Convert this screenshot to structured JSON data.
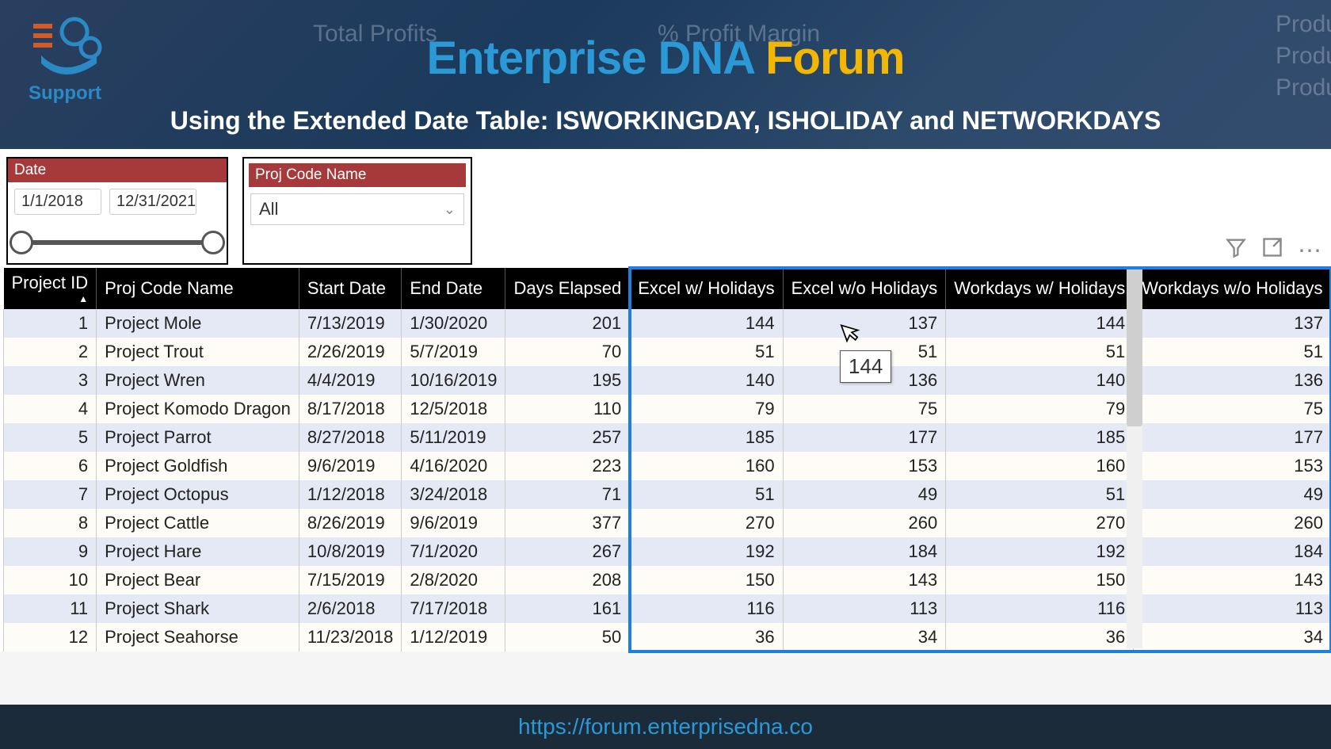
{
  "header": {
    "title_part1": "Enterprise DNA ",
    "title_part2": "Forum",
    "subtitle": "Using the Extended Date Table: ISWORKINGDAY, ISHOLIDAY and NETWORKDAYS",
    "support_label": "Support",
    "bg_profits": "Total Profits",
    "bg_margin": "% Profit Margin",
    "bg_prod": "Produ"
  },
  "slicers": {
    "date_label": "Date",
    "date_start": "1/1/2018",
    "date_end": "12/31/2021",
    "proj_label": "Proj Code Name",
    "proj_value": "All"
  },
  "table": {
    "columns": [
      "Project ID",
      "Proj Code Name",
      "Start Date",
      "End Date",
      "Days Elapsed",
      "Excel w/ Holidays",
      "Excel w/o Holidays",
      "Workdays w/ Holidays",
      "Workdays w/o Holidays"
    ],
    "rows": [
      {
        "id": "1",
        "name": "Project Mole",
        "start": "7/13/2019",
        "end": "1/30/2020",
        "elapsed": "201",
        "ewh": "144",
        "ewoh": "137",
        "wwh": "144",
        "wwoh": "137"
      },
      {
        "id": "2",
        "name": "Project Trout",
        "start": "2/26/2019",
        "end": "5/7/2019",
        "elapsed": "70",
        "ewh": "51",
        "ewoh": "51",
        "wwh": "51",
        "wwoh": "51"
      },
      {
        "id": "3",
        "name": "Project Wren",
        "start": "4/4/2019",
        "end": "10/16/2019",
        "elapsed": "195",
        "ewh": "140",
        "ewoh": "136",
        "wwh": "140",
        "wwoh": "136"
      },
      {
        "id": "4",
        "name": "Project Komodo Dragon",
        "start": "8/17/2018",
        "end": "12/5/2018",
        "elapsed": "110",
        "ewh": "79",
        "ewoh": "75",
        "wwh": "79",
        "wwoh": "75"
      },
      {
        "id": "5",
        "name": "Project Parrot",
        "start": "8/27/2018",
        "end": "5/11/2019",
        "elapsed": "257",
        "ewh": "185",
        "ewoh": "177",
        "wwh": "185",
        "wwoh": "177"
      },
      {
        "id": "6",
        "name": "Project Goldfish",
        "start": "9/6/2019",
        "end": "4/16/2020",
        "elapsed": "223",
        "ewh": "160",
        "ewoh": "153",
        "wwh": "160",
        "wwoh": "153"
      },
      {
        "id": "7",
        "name": "Project Octopus",
        "start": "1/12/2018",
        "end": "3/24/2018",
        "elapsed": "71",
        "ewh": "51",
        "ewoh": "49",
        "wwh": "51",
        "wwoh": "49"
      },
      {
        "id": "8",
        "name": "Project Cattle",
        "start": "8/26/2019",
        "end": "9/6/2019",
        "elapsed": "377",
        "ewh": "270",
        "ewoh": "260",
        "wwh": "270",
        "wwoh": "260"
      },
      {
        "id": "9",
        "name": "Project Hare",
        "start": "10/8/2019",
        "end": "7/1/2020",
        "elapsed": "267",
        "ewh": "192",
        "ewoh": "184",
        "wwh": "192",
        "wwoh": "184"
      },
      {
        "id": "10",
        "name": "Project Bear",
        "start": "7/15/2019",
        "end": "2/8/2020",
        "elapsed": "208",
        "ewh": "150",
        "ewoh": "143",
        "wwh": "150",
        "wwoh": "143"
      },
      {
        "id": "11",
        "name": "Project Shark",
        "start": "2/6/2018",
        "end": "7/17/2018",
        "elapsed": "161",
        "ewh": "116",
        "ewoh": "113",
        "wwh": "116",
        "wwoh": "113"
      },
      {
        "id": "12",
        "name": "Project Seahorse",
        "start": "11/23/2018",
        "end": "1/12/2019",
        "elapsed": "50",
        "ewh": "36",
        "ewoh": "34",
        "wwh": "36",
        "wwoh": "34"
      }
    ]
  },
  "tooltip_value": "144",
  "footer_url": "https://forum.enterprisedna.co"
}
